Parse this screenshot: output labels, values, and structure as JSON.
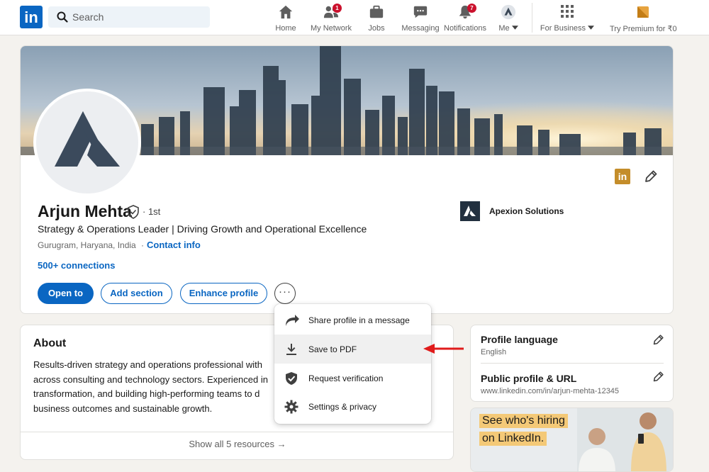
{
  "nav": {
    "logo": "in",
    "search_placeholder": "Search",
    "items": [
      {
        "label": "Home",
        "badge": ""
      },
      {
        "label": "My Network",
        "badge": "1"
      },
      {
        "label": "Jobs",
        "badge": ""
      },
      {
        "label": "Messaging",
        "badge": ""
      },
      {
        "label": "Notifications",
        "badge": "7"
      },
      {
        "label": "Me",
        "badge": ""
      },
      {
        "label": "For Business",
        "badge": ""
      },
      {
        "label": "Try Premium for ₹0",
        "badge": ""
      }
    ]
  },
  "profile": {
    "name": "Arjun Mehta",
    "degree": "· 1st",
    "headline": "Strategy & Operations Leader | Driving Growth and Operational Excellence",
    "location": "Gurugram, Haryana, India",
    "separator": "·",
    "contact_info": "Contact info",
    "connections": "500+ connections",
    "company": "Apexion Solutions",
    "in_badge": "in",
    "buttons": {
      "open_to": "Open to",
      "add_section": "Add section",
      "enhance_profile": "Enhance profile",
      "more": "···"
    }
  },
  "more_menu": {
    "items": [
      {
        "label": "Share profile in a message",
        "icon": "share-arrow-icon"
      },
      {
        "label": "Save to PDF",
        "icon": "download-icon",
        "highlighted": true
      },
      {
        "label": "Request verification",
        "icon": "verified-shield-icon"
      },
      {
        "label": "Settings & privacy",
        "icon": "gear-icon"
      }
    ]
  },
  "about": {
    "title": "About",
    "lines": [
      "Results-driven strategy and operations professional with",
      "across consulting and technology sectors. Experienced in",
      "transformation, and building high-performing teams to d",
      "business outcomes and sustainable growth."
    ],
    "show_all": "Show all 5 resources →"
  },
  "sidebar": {
    "profile_language_title": "Profile language",
    "profile_language_value": "English",
    "public_profile_title": "Public profile & URL",
    "public_profile_url": "www.linkedin.com/in/arjun-mehta-12345"
  },
  "ad": {
    "line1": "See who's hiring",
    "line2": "on LinkedIn."
  },
  "colors": {
    "brand": "#0a66c2",
    "badge": "#cb112d",
    "premium": "#c48d2a",
    "pointer_arrow": "#e01b1b"
  }
}
